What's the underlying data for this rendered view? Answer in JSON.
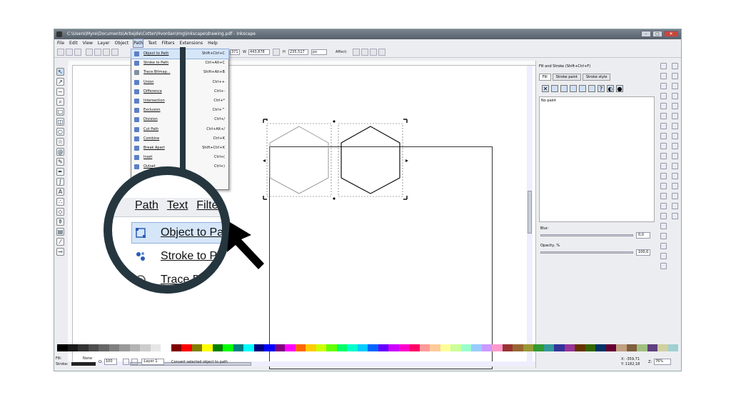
{
  "window": {
    "title": "C:\\Users\\Myre\\Documents\\Arbejde\\Cotter\\Hvordan\\Img\\Inkscape\\drawing.pdf - Inkscape",
    "buttons": [
      "–",
      "□",
      "✕"
    ]
  },
  "menubar": [
    "File",
    "Edit",
    "View",
    "Layer",
    "Object",
    "Path",
    "Text",
    "Filters",
    "Extensions",
    "Help"
  ],
  "controls": {
    "x_value": "371",
    "w_label": "W",
    "w_value": "443,878",
    "h_label": "H",
    "h_value": "235,517",
    "unit": "px",
    "affect_label": "Affect:"
  },
  "path_menu": {
    "items": [
      {
        "label": "Object to Path",
        "shortcut": "Shift+Ctrl+C",
        "highlighted": true
      },
      {
        "label": "Stroke to Path",
        "shortcut": "Ctrl+Alt+C"
      },
      {
        "label": "Trace Bitmap...",
        "shortcut": "Shift+Alt+B"
      },
      {
        "label": "Union",
        "shortcut": "Ctrl++"
      },
      {
        "label": "Difference",
        "shortcut": "Ctrl+-"
      },
      {
        "label": "Intersection",
        "shortcut": "Ctrl+*"
      },
      {
        "label": "Exclusion",
        "shortcut": "Ctrl+^"
      },
      {
        "label": "Division",
        "shortcut": "Ctrl+/"
      },
      {
        "label": "Cut Path",
        "shortcut": "Ctrl+Alt+/"
      },
      {
        "label": "Combine",
        "shortcut": "Ctrl+K"
      },
      {
        "label": "Break Apart",
        "shortcut": "Shift+Ctrl+K"
      },
      {
        "label": "Inset",
        "shortcut": "Ctrl+("
      },
      {
        "label": "Outset",
        "shortcut": "Ctrl+)"
      }
    ]
  },
  "fill_stroke": {
    "title": "Fill and Stroke (Shift+Ctrl+F)",
    "tabs": [
      "Fill",
      "Stroke paint",
      "Stroke style"
    ],
    "no_paint": "No paint",
    "blur_label": "Blur:",
    "blur_value": "0,0",
    "opacity_label": "Opacity, %",
    "opacity_value": "100,0"
  },
  "zoom": {
    "menu": [
      "Path",
      "Text",
      "Filte"
    ],
    "items": [
      "Object to Path",
      "Stroke to Path",
      "Trace Bitmap"
    ]
  },
  "status": {
    "fill_label": "Fill:",
    "fill_value": "None",
    "stroke_label": "Stroke:",
    "opacity_label": "O:",
    "opacity_value": "100",
    "layer": "-Layer 1",
    "message": "Convert selected object to path",
    "coords_x": "X: -359,71",
    "coords_y": "Y: 1182,18",
    "zoom_label": "Z:",
    "zoom_value": "76%"
  },
  "colors": {
    "accent": "#cfe0f6",
    "magnifier": "#25363f"
  },
  "palette": [
    "#000000",
    "#1a1a1a",
    "#333333",
    "#4d4d4d",
    "#666666",
    "#808080",
    "#999999",
    "#b3b3b3",
    "#cccccc",
    "#e6e6e6",
    "#ffffff",
    "#800000",
    "#ff0000",
    "#808000",
    "#ffff00",
    "#008000",
    "#00ff00",
    "#008080",
    "#00ffff",
    "#000080",
    "#0000ff",
    "#800080",
    "#ff00ff",
    "#ff6600",
    "#ffcc00",
    "#ccff00",
    "#66ff00",
    "#00ff66",
    "#00ffcc",
    "#00ccff",
    "#0066ff",
    "#6600ff",
    "#cc00ff",
    "#ff00cc",
    "#ff0066",
    "#ff9999",
    "#ffcc99",
    "#ffff99",
    "#ccff99",
    "#99ffcc",
    "#99ccff",
    "#cc99ff",
    "#ff99cc",
    "#993333",
    "#996633",
    "#999933",
    "#339933",
    "#339999",
    "#333399",
    "#993399",
    "#663300",
    "#336600",
    "#003366",
    "#660033",
    "#c0a080",
    "#806040",
    "#a0c080",
    "#604080",
    "#d0d0a0",
    "#a0d0d0"
  ]
}
